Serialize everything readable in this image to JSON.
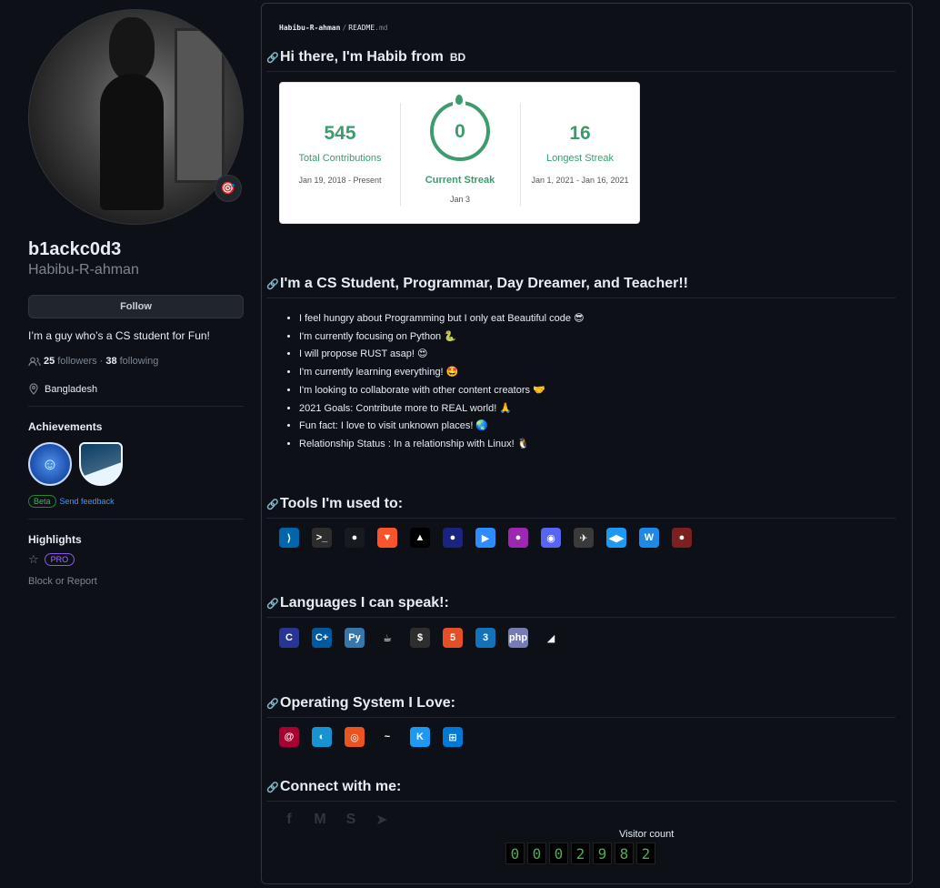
{
  "profile": {
    "nickname": "b1ackc0d3",
    "username": "Habibu-R-ahman",
    "follow_label": "Follow",
    "bio": "I’m a guy who’s a CS student for Fun!",
    "followers_count": "25",
    "followers_label": "followers",
    "separator": "·",
    "following_count": "38",
    "following_label": "following",
    "location": "Bangladesh",
    "status_emoji": "🎯"
  },
  "achievements": {
    "title": "Achievements",
    "items": [
      {
        "name": "yolo-achievement-icon"
      },
      {
        "name": "pull-shark-achievement-icon"
      }
    ],
    "beta_label": "Beta",
    "feedback_label": "Send feedback"
  },
  "highlights": {
    "title": "Highlights",
    "pro_label": "PRO"
  },
  "block_label": "Block or Report",
  "readme": {
    "path": {
      "owner": "Habibu-R-ahman",
      "sep": "/",
      "file": "README",
      "ext": ".md"
    },
    "h1": "Hi there, I'm Habib from",
    "flag": "BD",
    "streak": {
      "total": "545",
      "total_label": "Total Contributions",
      "total_range": "Jan 19, 2018 - Present",
      "current": "0",
      "current_label": "Current Streak",
      "current_date": "Jan 3",
      "longest": "16",
      "longest_label": "Longest Streak",
      "longest_range": "Jan 1, 2021 - Jan 16, 2021"
    },
    "h2": "I'm a CS Student, Programmar, Day Dreamer, and Teacher!!",
    "bullets": [
      "I feel hungry about Programming but I only eat Beautiful code 😎",
      "I'm currently focusing on Python 🐍",
      "I will propose RUST asap! 😍",
      "I'm currently learning everything! 🤩",
      "I'm looking to collaborate with other content creators 🤝",
      "2021 Goals: Contribute more to REAL world! 🙏",
      "Fun fact: I love to visit unknown places! 🌏",
      "Relationship Status : In a relationship with Linux! 🐧"
    ],
    "tools_title": "Tools I'm used to:",
    "tools": [
      {
        "name": "vscode-icon",
        "glyph": "⟩",
        "bg": "#0065a9"
      },
      {
        "name": "terminal-icon",
        "glyph": ">_",
        "bg": "#2d2d2d"
      },
      {
        "name": "github-icon",
        "glyph": "●",
        "bg": "#161b22"
      },
      {
        "name": "brave-icon",
        "glyph": "▼",
        "bg": "#fb542b"
      },
      {
        "name": "linux-penguin-icon",
        "glyph": "▲",
        "bg": "#000000"
      },
      {
        "name": "burp-icon",
        "glyph": "●",
        "bg": "#1a237e"
      },
      {
        "name": "zoom-icon",
        "glyph": "▶",
        "bg": "#2d8cff"
      },
      {
        "name": "firefox-icon",
        "glyph": "●",
        "bg": "#9c27b0"
      },
      {
        "name": "discord-icon",
        "glyph": "◉",
        "bg": "#5865f2"
      },
      {
        "name": "wireshark-icon",
        "glyph": "✈",
        "bg": "#3a3a3a"
      },
      {
        "name": "kdenlive-icon",
        "glyph": "◀▶",
        "bg": "#1d99f3"
      },
      {
        "name": "writer-icon",
        "glyph": "W",
        "bg": "#1e88e5"
      },
      {
        "name": "obs-icon",
        "glyph": "●",
        "bg": "#7a2020"
      }
    ],
    "langs_title": "Languages I can speak!:",
    "langs": [
      {
        "name": "c-icon",
        "glyph": "C",
        "bg": "#283593"
      },
      {
        "name": "cpp-icon",
        "glyph": "C+",
        "bg": "#00599c"
      },
      {
        "name": "python-icon",
        "glyph": "Py",
        "bg": "#3776ab"
      },
      {
        "name": "java-icon",
        "glyph": "☕",
        "bg": "#0d1117"
      },
      {
        "name": "bash-icon",
        "glyph": "$",
        "bg": "#2e2e2e"
      },
      {
        "name": "html5-icon",
        "glyph": "5",
        "bg": "#e34f26"
      },
      {
        "name": "css3-icon",
        "glyph": "3",
        "bg": "#1572b6"
      },
      {
        "name": "php-icon",
        "glyph": "php",
        "bg": "#777bb3"
      },
      {
        "name": "mysql-icon",
        "glyph": "◢",
        "bg": "#0d1117"
      }
    ],
    "os_title": "Operating System I Love:",
    "os": [
      {
        "name": "debian-icon",
        "glyph": "@",
        "bg": "#a80030"
      },
      {
        "name": "arch-icon",
        "glyph": "◐",
        "bg": "#1793d1"
      },
      {
        "name": "ubuntu-icon",
        "glyph": "◎",
        "bg": "#e95420"
      },
      {
        "name": "kali-icon",
        "glyph": "~",
        "bg": "#0d1117"
      },
      {
        "name": "kde-icon",
        "glyph": "K",
        "bg": "#1d99f3"
      },
      {
        "name": "windows-icon",
        "glyph": "⊞",
        "bg": "#0078d4"
      }
    ],
    "connect_title": "Connect with me:",
    "social": [
      {
        "name": "facebook-icon",
        "glyph": "f"
      },
      {
        "name": "gmail-icon",
        "glyph": "M"
      },
      {
        "name": "skype-icon",
        "glyph": "S"
      },
      {
        "name": "telegram-icon",
        "glyph": "➤"
      }
    ],
    "visitor_label": "Visitor count",
    "visitor_digits": [
      "0",
      "0",
      "0",
      "2",
      "9",
      "8",
      "2"
    ]
  }
}
